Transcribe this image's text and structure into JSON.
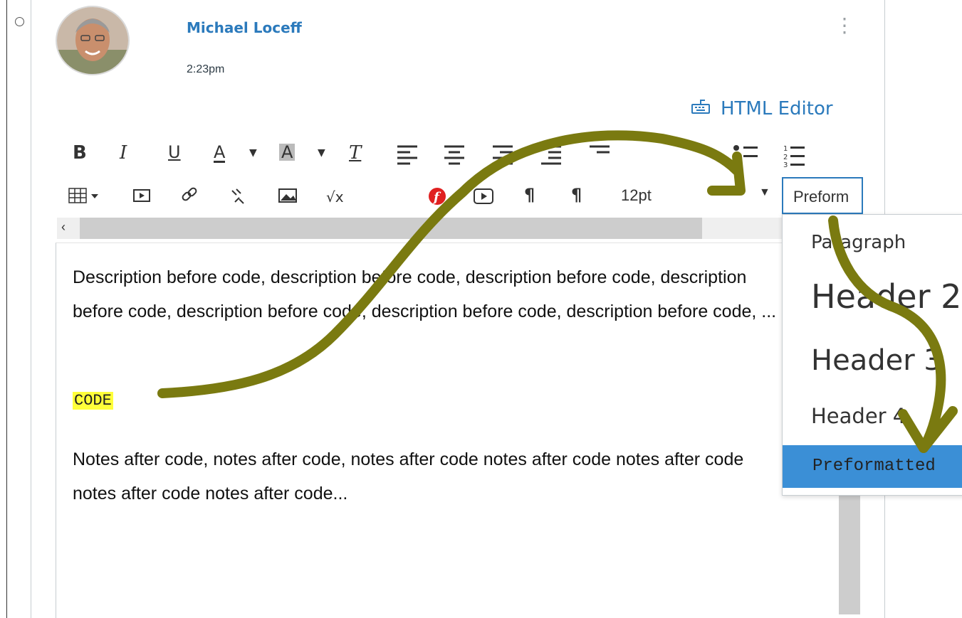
{
  "post": {
    "author": "Michael Loceff",
    "time": "2:23pm",
    "html_editor_label": "HTML Editor"
  },
  "toolbar": {
    "bold": "B",
    "italic": "I",
    "underline": "U",
    "font_color": "A",
    "background_color": "A",
    "clear_formatting": "T",
    "font_size": "12pt",
    "format_value": "Preform"
  },
  "editor": {
    "paragraph_before": "Description before code, description before code, description before code, description before code, description before code, description before code, description before code, ...",
    "code_text": "CODE",
    "paragraph_after": "Notes after code, notes after code, notes after code notes after code notes after code notes after code notes after code..."
  },
  "format_menu": {
    "items": [
      {
        "label": "Paragraph"
      },
      {
        "label": "Header 2"
      },
      {
        "label": "Header 3"
      },
      {
        "label": "Header 4"
      },
      {
        "label": "Preformatted"
      }
    ],
    "selected_index": 4
  },
  "colors": {
    "link_blue": "#2b7abc",
    "highlight_yellow": "#ffff3a",
    "menu_selected": "#3b8fd6",
    "annotation_arrow": "#7a7a10"
  }
}
